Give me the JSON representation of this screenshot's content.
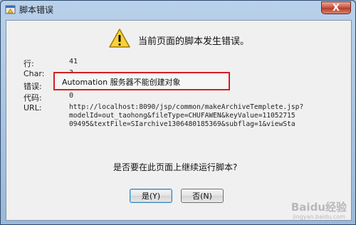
{
  "window": {
    "title": "脚本错误",
    "close_label": "X"
  },
  "dialog": {
    "headline": "当前页面的脚本发生错误。",
    "fields": {
      "line_label": "行:",
      "line_value": "41",
      "char_label": "Char:",
      "char_value": "3",
      "error_label": "错误:",
      "error_value": "Automation 服务器不能创建对象",
      "code_label": "代码:",
      "code_value": "0",
      "url_label": "URL:",
      "url_lines": [
        "http://localhost:8090/jsp/common/makeArchiveTemplete.jsp?",
        "modelId=out_taohong&fileType=CHUFAWEN&keyValue=11052715",
        "09495&textFile=SIarchive1306480185369&subflag=1&viewSta"
      ]
    },
    "question": "是否要在此页面上继续运行脚本?",
    "buttons": {
      "yes": "是(Y)",
      "no": "否(N)"
    }
  },
  "watermark": {
    "brand": "Baidu经验",
    "sub": "jingyan.baidu.com"
  },
  "colors": {
    "highlight_border": "#d42020",
    "dialog_bg": "#f0f0f0"
  }
}
